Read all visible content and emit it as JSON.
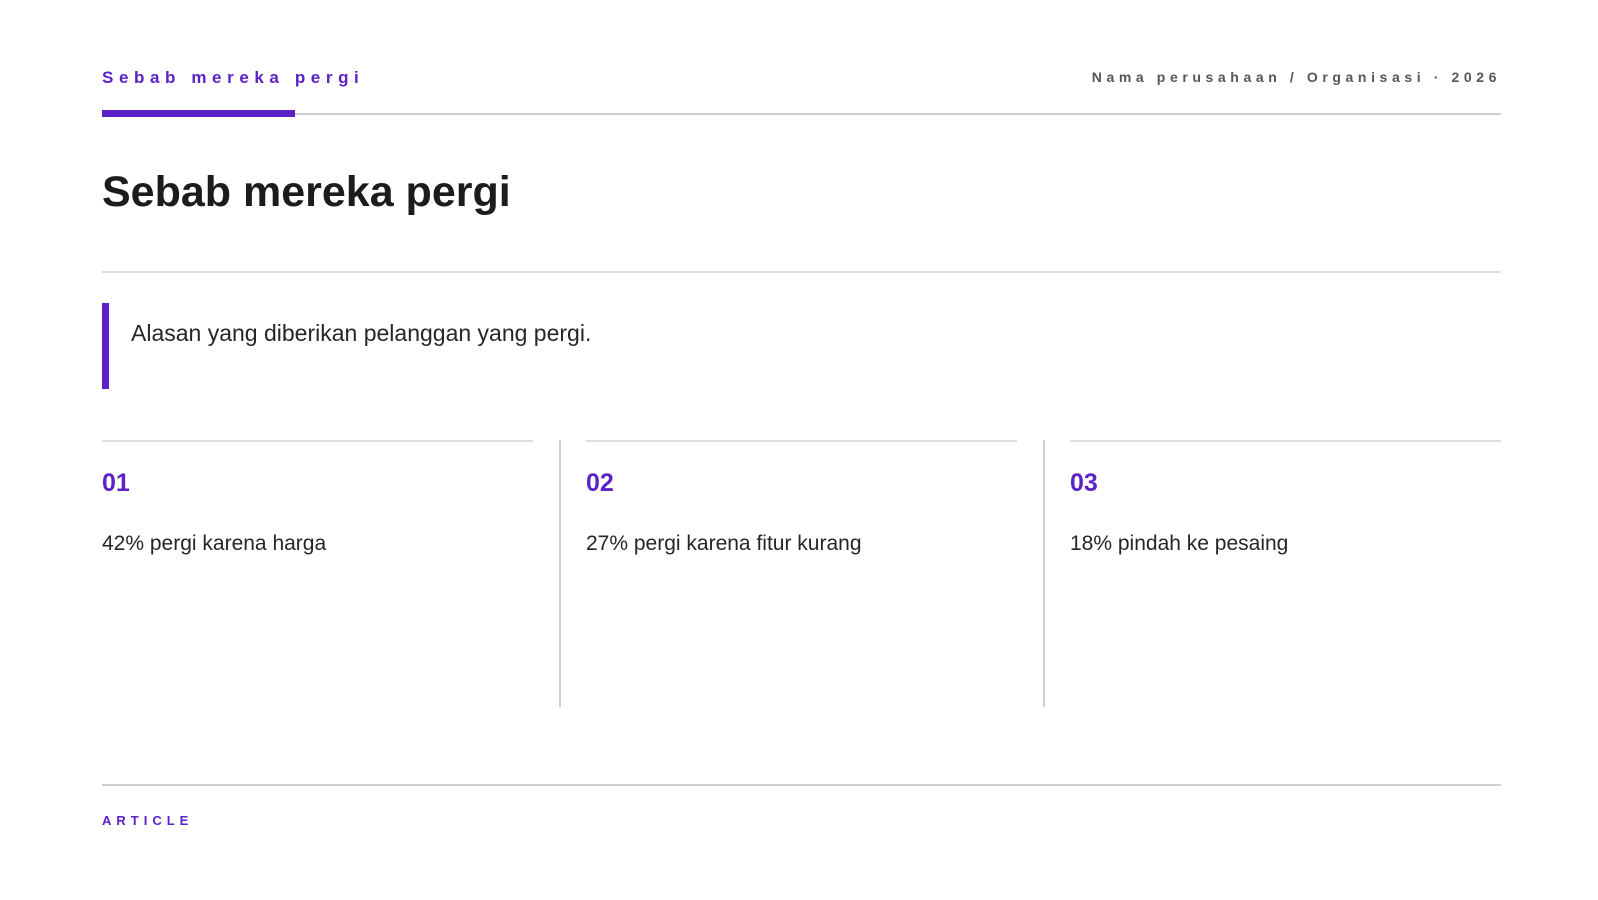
{
  "header": {
    "kicker": "Sebab mereka pergi",
    "organization": "Nama perusahaan / Organisasi · 2026"
  },
  "title": "Sebab mereka pergi",
  "quote": "Alasan yang diberikan pelanggan yang pergi.",
  "cards": [
    {
      "number": "01",
      "text": "42% pergi karena harga"
    },
    {
      "number": "02",
      "text": "27% pergi karena fitur kurang"
    },
    {
      "number": "03",
      "text": "18% pindah ke pesaing"
    }
  ],
  "footer": {
    "label": "ARTICLE"
  },
  "colors": {
    "accent": "#5b22c7",
    "text": "#1c1c1e",
    "muted": "#55555a",
    "rule": "#cfcfd3"
  }
}
